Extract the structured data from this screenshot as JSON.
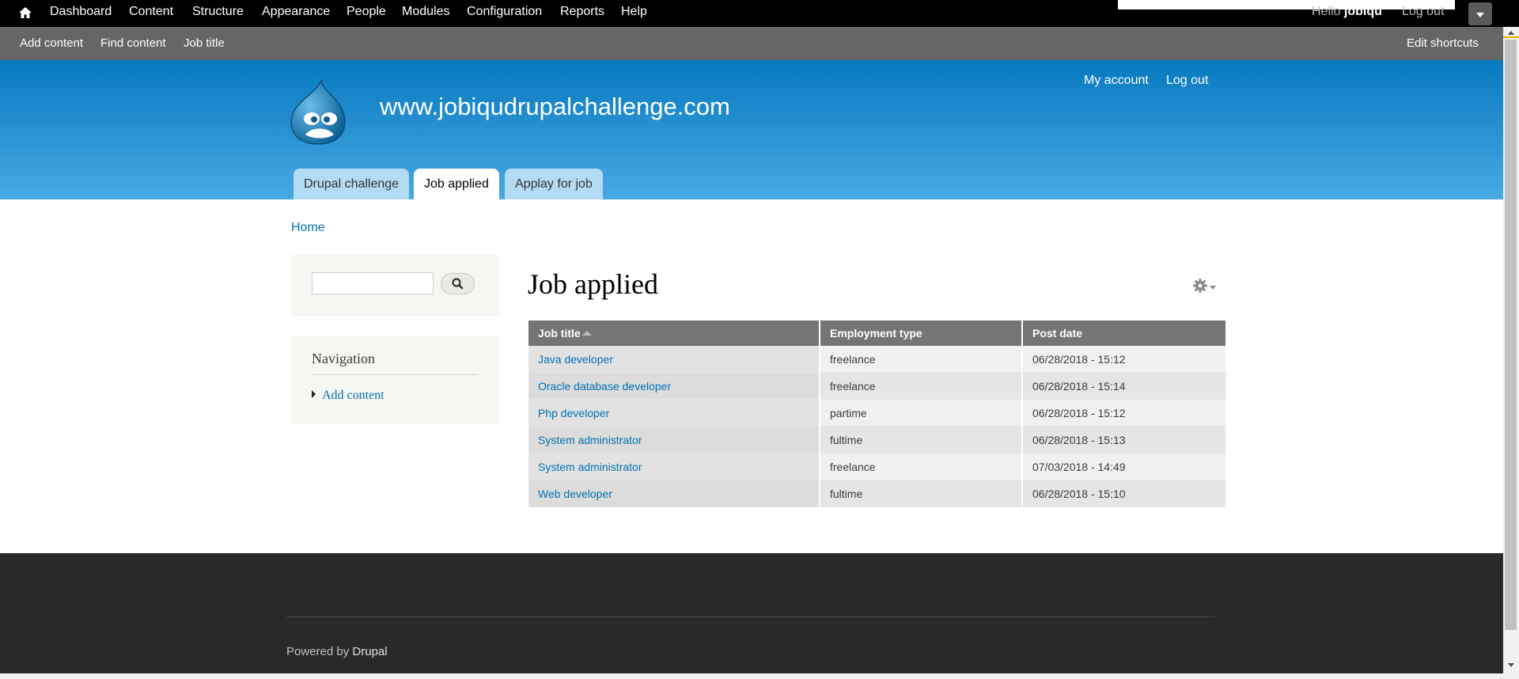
{
  "toolbar": {
    "menu": [
      "Dashboard",
      "Content",
      "Structure",
      "Appearance",
      "People",
      "Modules",
      "Configuration",
      "Reports",
      "Help"
    ],
    "hello_prefix": "Hello ",
    "user": "jobiqu",
    "logout": "Log out"
  },
  "shortcuts": {
    "items": [
      "Add content",
      "Find content",
      "Job title"
    ],
    "edit": "Edit shortcuts"
  },
  "header": {
    "site_name": "www.jobiqudrupalchallenge.com",
    "secondary": [
      "My account",
      "Log out"
    ],
    "tabs": [
      "Drupal challenge",
      "Job applied",
      "Applay for job"
    ],
    "active_tab": "Job applied"
  },
  "breadcrumb": "Home",
  "sidebar": {
    "search_value": "",
    "navigation_title": "Navigation",
    "navigation_item": "Add content"
  },
  "page_title": "Job applied",
  "table": {
    "columns": [
      "Job title",
      "Employment type",
      "Post date"
    ],
    "sorted_by": "Job title",
    "rows": [
      [
        "Java developer",
        "freelance",
        "06/28/2018 - 15:12"
      ],
      [
        "Oracle database developer",
        "freelance",
        "06/28/2018 - 15:14"
      ],
      [
        "Php developer",
        "partime",
        "06/28/2018 - 15:12"
      ],
      [
        "System administrator",
        "fultime",
        "06/28/2018 - 15:13"
      ],
      [
        "System administrator",
        "freelance",
        "07/03/2018 - 14:49"
      ],
      [
        "Web developer",
        "fultime",
        "06/28/2018 - 15:10"
      ]
    ]
  },
  "footer": {
    "powered_prefix": "Powered by ",
    "powered_link": "Drupal"
  },
  "colors": {
    "header_top": "#0779bf",
    "header_bottom": "#48a9e4",
    "link": "#0071b3",
    "footer": "#292929"
  }
}
